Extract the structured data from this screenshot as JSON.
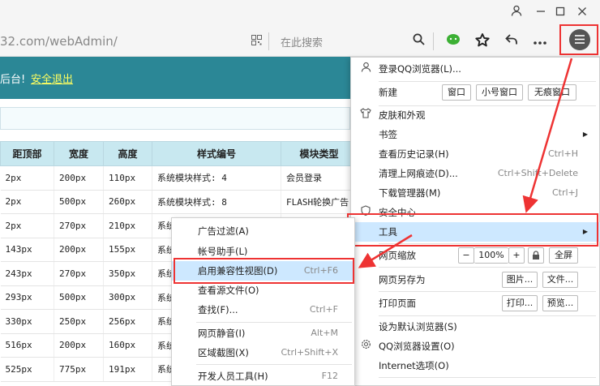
{
  "address": {
    "url_dim": "32.com/",
    "url_path": "webAdmin/",
    "search_placeholder": "在此搜索"
  },
  "banner": {
    "text": "后台!",
    "logout": "安全退出"
  },
  "table": {
    "headers": [
      "距顶部",
      "宽度",
      "高度",
      "样式编号",
      "模块类型"
    ],
    "rows": [
      [
        "2px",
        "200px",
        "110px",
        "系统模块样式: 4",
        "会员登录"
      ],
      [
        "2px",
        "500px",
        "260px",
        "系统模块样式: 8",
        "FLASH轮换广告"
      ],
      [
        "2px",
        "270px",
        "210px",
        "系统",
        ""
      ],
      [
        "143px",
        "200px",
        "155px",
        "系统",
        ""
      ],
      [
        "243px",
        "270px",
        "350px",
        "系统",
        ""
      ],
      [
        "293px",
        "500px",
        "300px",
        "系统",
        ""
      ],
      [
        "330px",
        "250px",
        "256px",
        "系统",
        ""
      ],
      [
        "516px",
        "200px",
        "160px",
        "系统",
        ""
      ],
      [
        "525px",
        "775px",
        "191px",
        "系统",
        ""
      ]
    ]
  },
  "menu": {
    "login": "登录QQ浏览器(L)...",
    "new_label": "新建",
    "new_window": "窗口",
    "new_small": "小号窗口",
    "new_private": "无痕窗口",
    "skin": "皮肤和外观",
    "bookmarks": "书签",
    "history": "查看历史记录(H)",
    "history_sc": "Ctrl+H",
    "clear": "清理上网痕迹(D)...",
    "clear_sc": "Ctrl+Shift+Delete",
    "downloads": "下载管理器(M)",
    "downloads_sc": "Ctrl+J",
    "security": "安全中心",
    "tools": "工具",
    "zoom_label": "网页缩放",
    "zoom_minus": "−",
    "zoom_value": "100%",
    "zoom_plus": "+",
    "fullscreen": "全屏",
    "saveas": "网页另存为",
    "save_image": "图片...",
    "save_file": "文件...",
    "print": "打印页面",
    "print_btn": "打印...",
    "preview_btn": "预览...",
    "default_browser": "设为默认浏览器(S)",
    "settings": "QQ浏览器设置(O)",
    "internet_options": "Internet选项(O)"
  },
  "submenu": {
    "adfilter": "广告过滤(A)",
    "account": "帐号助手(L)",
    "compat": "启用兼容性视图(D)",
    "compat_sc": "Ctrl+F6",
    "source": "查看源文件(O)",
    "find": "查找(F)...",
    "find_sc": "Ctrl+F",
    "mute": "网页静音(I)",
    "mute_sc": "Alt+M",
    "screenshot": "区域截图(X)",
    "screenshot_sc": "Ctrl+Shift+X",
    "devtools": "开发人员工具(H)",
    "devtools_sc": "F12"
  },
  "colors": {
    "accent_red": "#e33333",
    "banner": "#2b8796",
    "highlight": "#cde8ff"
  }
}
